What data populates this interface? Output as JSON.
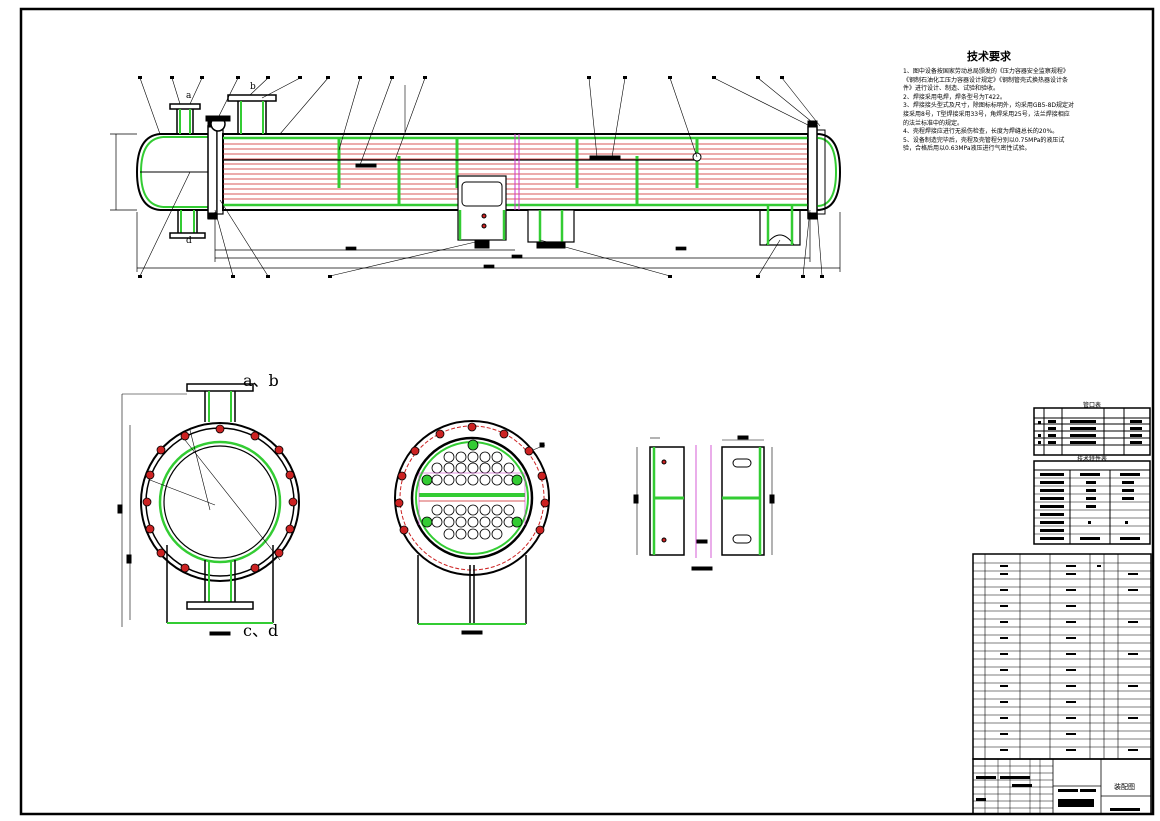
{
  "drawing": {
    "colors": {
      "line": "#000000",
      "weld": "#33cc33",
      "tube": "#cc2222",
      "center": "#cc33cc",
      "background": "#ffffff"
    },
    "tech_requirements": {
      "title": "技术要求",
      "lines": [
        "1、图中设备按国家劳动总局颁发的《压力容器安全监察规程》《钢制石油化工压力容器设计规定》《钢制管壳式换热器设计条件》进行设计、制造、试验和验收。",
        "2、焊接采用电焊，焊条型号为T422。",
        "3、焊接接头型式及尺寸，除图标标明外，均采用GB5-8D规定对接采用8号，T型焊接采用33号，角焊采用25号，法兰焊接相应的法兰标准中的规定。",
        "4、壳程焊接应进行无损伤检查，长度为焊缝总长的20%。",
        "5、设备制造完毕后，壳程及壳管程分别以0.75MPa的液压试验，合格后用以0.63MPa液压进行气密性试验。"
      ]
    },
    "view_labels": {
      "nozzle_top_pair": "a、b",
      "nozzle_bottom_pair": "c、d",
      "nozzle_a": "a",
      "nozzle_b": "b",
      "nozzle_d": "d"
    },
    "tables": {
      "nozzle_table_title": "管口表",
      "tech_spec_title": "技术特性表"
    },
    "title_block": {
      "drawing_name": "装配图"
    }
  }
}
